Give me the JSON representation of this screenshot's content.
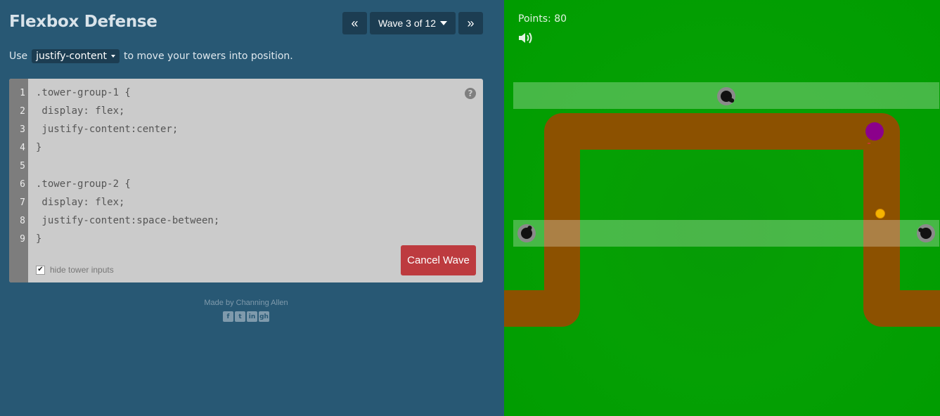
{
  "app": {
    "title": "Flexbox Defense"
  },
  "wave_nav": {
    "prev_icon": "«",
    "label": "Wave 3 of 12",
    "next_icon": "»"
  },
  "instruction": {
    "prefix": "Use",
    "property": "justify-content",
    "suffix": "to move your towers into position."
  },
  "editor": {
    "line_numbers": [
      "1",
      "2",
      "3",
      "4",
      "5",
      "6",
      "7",
      "8",
      "9"
    ],
    "lines": [
      ".tower-group-1 {",
      " display: flex;",
      " justify-content:center;",
      "}",
      "",
      ".tower-group-2 {",
      " display: flex;",
      " justify-content:space-between;",
      "}"
    ],
    "help_label": "?",
    "hide_inputs_label": "hide tower inputs",
    "hide_inputs_checked": true,
    "cancel_button": "Cancel Wave"
  },
  "footer": {
    "credit": "Made by Channing Allen",
    "social_icons": [
      "facebook-icon",
      "twitter-icon",
      "linkedin-icon",
      "github-icon"
    ],
    "social_glyphs": [
      "f",
      "t",
      "in",
      "gh"
    ]
  },
  "game": {
    "points_label": "Points: 80",
    "colors": {
      "grass": "#05a004",
      "path": "#8c5100",
      "enemy": "#8b008b",
      "coin": "#f5b400",
      "tower_row": "rgba(255,255,255,0.27)"
    }
  },
  "colors": {
    "panel_bg": "#285874",
    "button_bg": "#1c3d52",
    "editor_bg": "#cbcbcb",
    "gutter_bg": "#7d7d7d",
    "cancel_bg": "#bd3b3f"
  }
}
